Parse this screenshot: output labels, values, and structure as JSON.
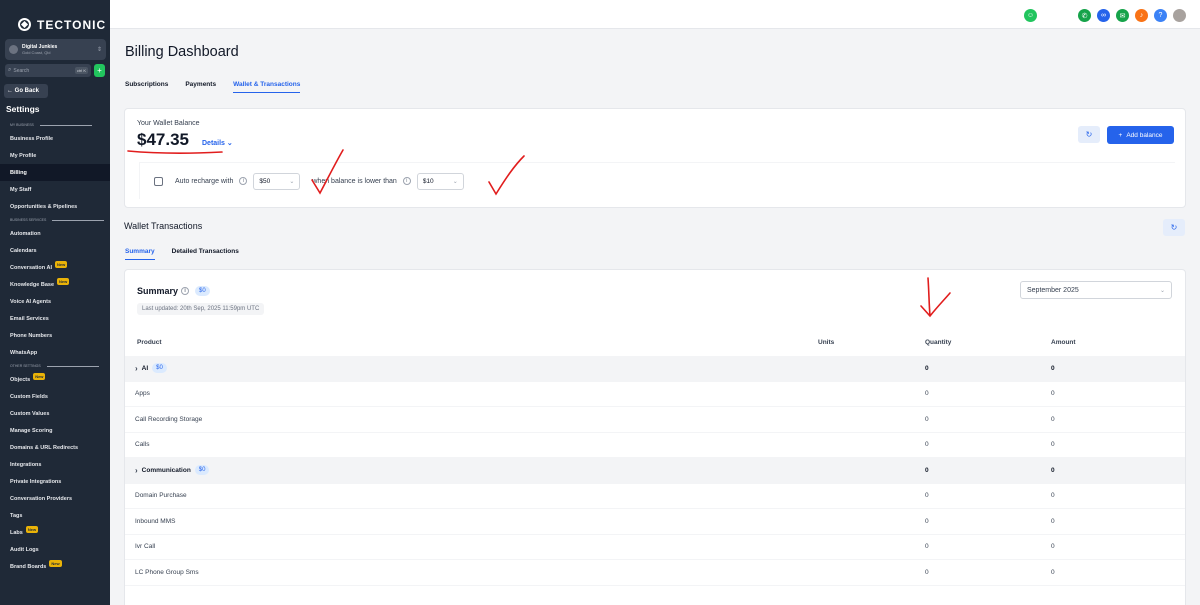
{
  "brand": {
    "name": "TECTONIC"
  },
  "account": {
    "name": "Digital Junkies",
    "location": "Gold Coast, Qld"
  },
  "search": {
    "placeholder": "Search",
    "shortcut": "ctrl K"
  },
  "sidebar": {
    "go_back": "← Go Back",
    "title": "Settings",
    "new_badge": "New",
    "sections": [
      {
        "label": "MY BUSINESS",
        "items": [
          {
            "label": "Business Profile",
            "new": false,
            "active": false
          },
          {
            "label": "My Profile",
            "new": false,
            "active": false
          },
          {
            "label": "Billing",
            "new": false,
            "active": true
          },
          {
            "label": "My Staff",
            "new": false,
            "active": false
          },
          {
            "label": "Opportunities & Pipelines",
            "new": false,
            "active": false
          }
        ]
      },
      {
        "label": "BUSINESS SERVICES",
        "items": [
          {
            "label": "Automation",
            "new": false,
            "active": false
          },
          {
            "label": "Calendars",
            "new": false,
            "active": false
          },
          {
            "label": "Conversation AI",
            "new": true,
            "active": false
          },
          {
            "label": "Knowledge Base",
            "new": true,
            "active": false
          },
          {
            "label": "Voice AI Agents",
            "new": false,
            "active": false
          },
          {
            "label": "Email Services",
            "new": false,
            "active": false
          },
          {
            "label": "Phone Numbers",
            "new": false,
            "active": false
          },
          {
            "label": "WhatsApp",
            "new": false,
            "active": false
          }
        ]
      },
      {
        "label": "OTHER SETTINGS",
        "items": [
          {
            "label": "Objects",
            "new": true,
            "active": false
          },
          {
            "label": "Custom Fields",
            "new": false,
            "active": false
          },
          {
            "label": "Custom Values",
            "new": false,
            "active": false
          },
          {
            "label": "Manage Scoring",
            "new": false,
            "active": false
          },
          {
            "label": "Domains & URL Redirects",
            "new": false,
            "active": false
          },
          {
            "label": "Integrations",
            "new": false,
            "active": false
          },
          {
            "label": "Private Integrations",
            "new": false,
            "active": false
          },
          {
            "label": "Conversation Providers",
            "new": false,
            "active": false
          },
          {
            "label": "Tags",
            "new": false,
            "active": false
          },
          {
            "label": "Labs",
            "new": true,
            "active": false
          },
          {
            "label": "Audit Logs",
            "new": false,
            "active": false
          },
          {
            "label": "Brand Boards",
            "new": true,
            "active": false
          }
        ]
      }
    ]
  },
  "topbar": {
    "icons": [
      {
        "name": "bot-icon",
        "color": "#22c55e"
      },
      {
        "name": "phone-icon",
        "color": "#16a34a"
      },
      {
        "name": "link-icon",
        "color": "#2563eb"
      },
      {
        "name": "megaphone-icon",
        "color": "#16a34a"
      },
      {
        "name": "bell-icon",
        "color": "#f97316"
      },
      {
        "name": "help-icon",
        "color": "#3b82f6"
      }
    ]
  },
  "page": {
    "title": "Billing Dashboard",
    "tabs": [
      "Subscriptions",
      "Payments",
      "Wallet & Transactions"
    ],
    "active_tab": 2
  },
  "wallet": {
    "label": "Your Wallet Balance",
    "balance": "$47.35",
    "details_link": "Details ⌄",
    "add_balance": "Add balance",
    "recharge_label": "Auto recharge with",
    "recharge_amount": "$50",
    "threshold_label": "when balance is lower than",
    "threshold_amount": "$10"
  },
  "transactions": {
    "title": "Wallet Transactions",
    "tabs": [
      "Summary",
      "Detailed Transactions"
    ],
    "active_tab": 0,
    "summary": {
      "title": "Summary",
      "total": "$0",
      "last_updated": "Last updated: 20th Sep, 2025 11:59pm UTC",
      "month": "September 2025"
    },
    "columns": [
      "Product",
      "Units",
      "Quantity",
      "Amount"
    ],
    "rows": [
      {
        "product": "AI",
        "group": true,
        "pill": "$0",
        "units": "",
        "quantity": "0",
        "amount": "0"
      },
      {
        "product": "Apps",
        "group": false,
        "units": "",
        "quantity": "0",
        "amount": "0"
      },
      {
        "product": "Call Recording Storage",
        "group": false,
        "units": "",
        "quantity": "0",
        "amount": "0"
      },
      {
        "product": "Calls",
        "group": false,
        "units": "",
        "quantity": "0",
        "amount": "0"
      },
      {
        "product": "Communication",
        "group": true,
        "pill": "$0",
        "units": "",
        "quantity": "0",
        "amount": "0"
      },
      {
        "product": "Domain Purchase",
        "group": false,
        "units": "",
        "quantity": "0",
        "amount": "0"
      },
      {
        "product": "Inbound MMS",
        "group": false,
        "units": "",
        "quantity": "0",
        "amount": "0"
      },
      {
        "product": "Ivr Call",
        "group": false,
        "units": "",
        "quantity": "0",
        "amount": "0"
      },
      {
        "product": "LC Phone Group Sms",
        "group": false,
        "units": "",
        "quantity": "0",
        "amount": "0"
      }
    ]
  },
  "colors": {
    "accent": "#2563eb",
    "sidebar_bg": "#1f2937",
    "annotation": "#e11d1d"
  }
}
